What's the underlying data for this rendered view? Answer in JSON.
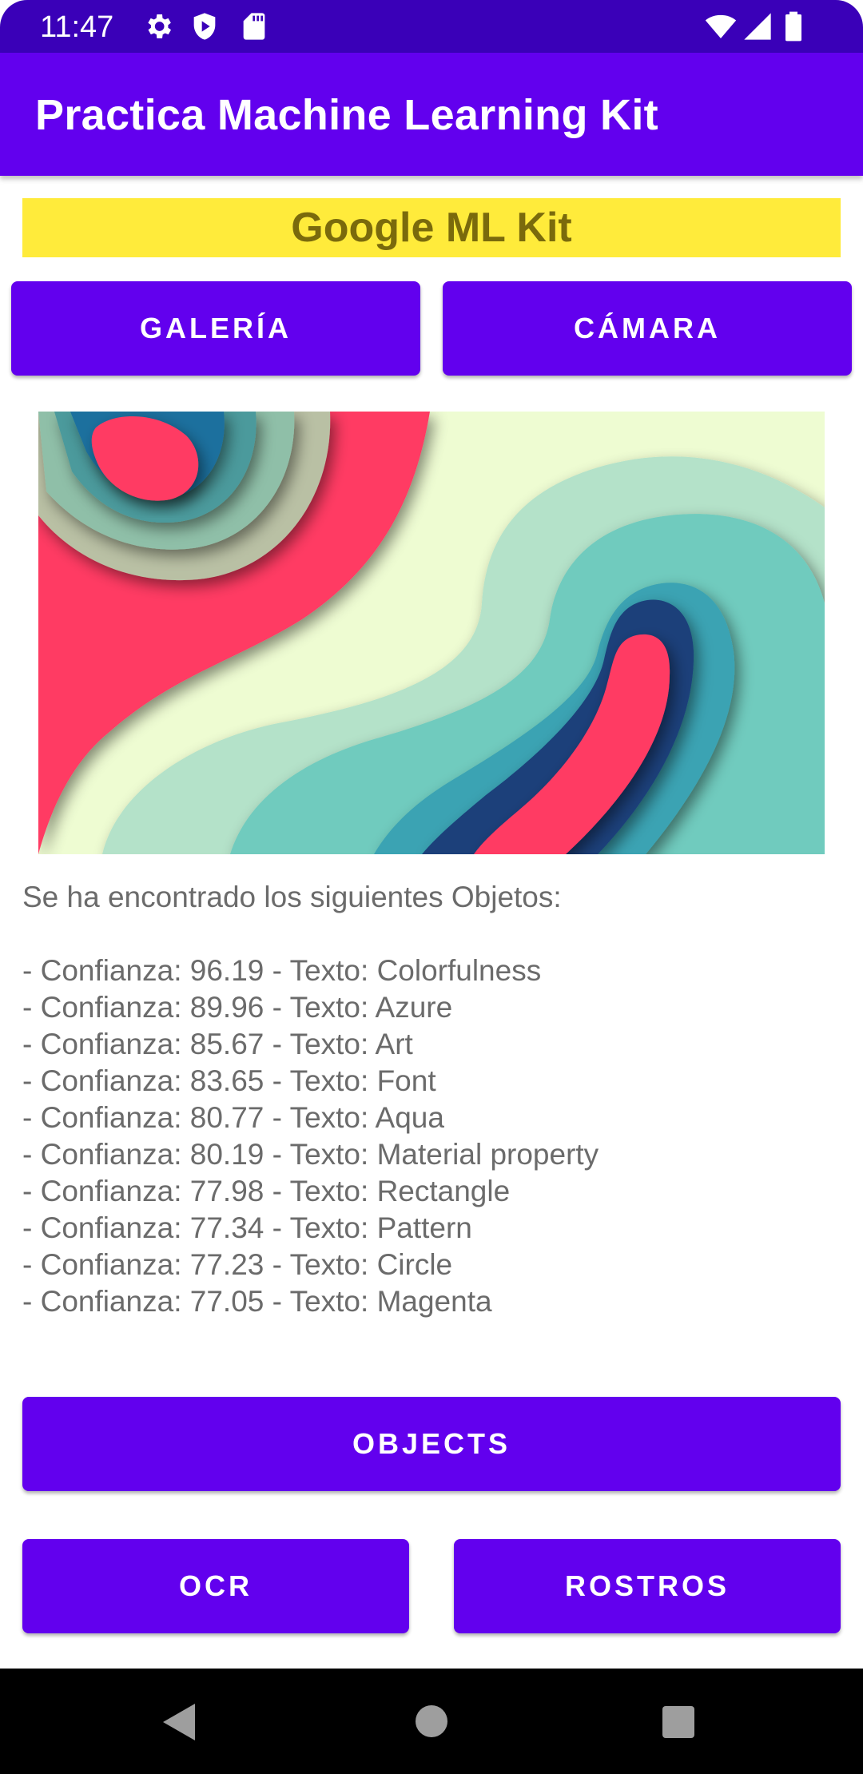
{
  "status_bar": {
    "time": "11:47",
    "icons": [
      "gear-icon",
      "shield-play-icon",
      "sd-card-icon",
      "wifi-icon",
      "signal-icon",
      "battery-icon"
    ]
  },
  "app_bar": {
    "title": "Practica Machine Learning Kit"
  },
  "banner": {
    "text": "Google ML Kit"
  },
  "buttons": {
    "gallery": "GALERÍA",
    "camera": "CÁMARA",
    "objects": "OBJECTS",
    "ocr": "OCR",
    "faces": "ROSTROS"
  },
  "results": {
    "heading": "Se ha encontrado los siguientes Objetos:",
    "items": [
      "- Confianza: 96.19 - Texto: Colorfulness",
      "- Confianza: 89.96 - Texto: Azure",
      "- Confianza: 85.67 - Texto: Art",
      "- Confianza: 83.65 - Texto: Font",
      "- Confianza: 80.77 - Texto: Aqua",
      "- Confianza: 80.19 - Texto: Material property",
      "- Confianza: 77.98 - Texto: Rectangle",
      "- Confianza: 77.34 - Texto: Pattern",
      "- Confianza: 77.23 - Texto: Circle",
      "- Confianza: 77.05 - Texto: Magenta"
    ]
  },
  "nav_bar": {
    "icons": [
      "back-icon",
      "home-icon",
      "recents-icon"
    ]
  },
  "colors": {
    "primary": "#6200ee",
    "status_bar": "#3a00b8",
    "banner_bg": "#ffeb3b",
    "banner_text": "#7a6a0c"
  }
}
